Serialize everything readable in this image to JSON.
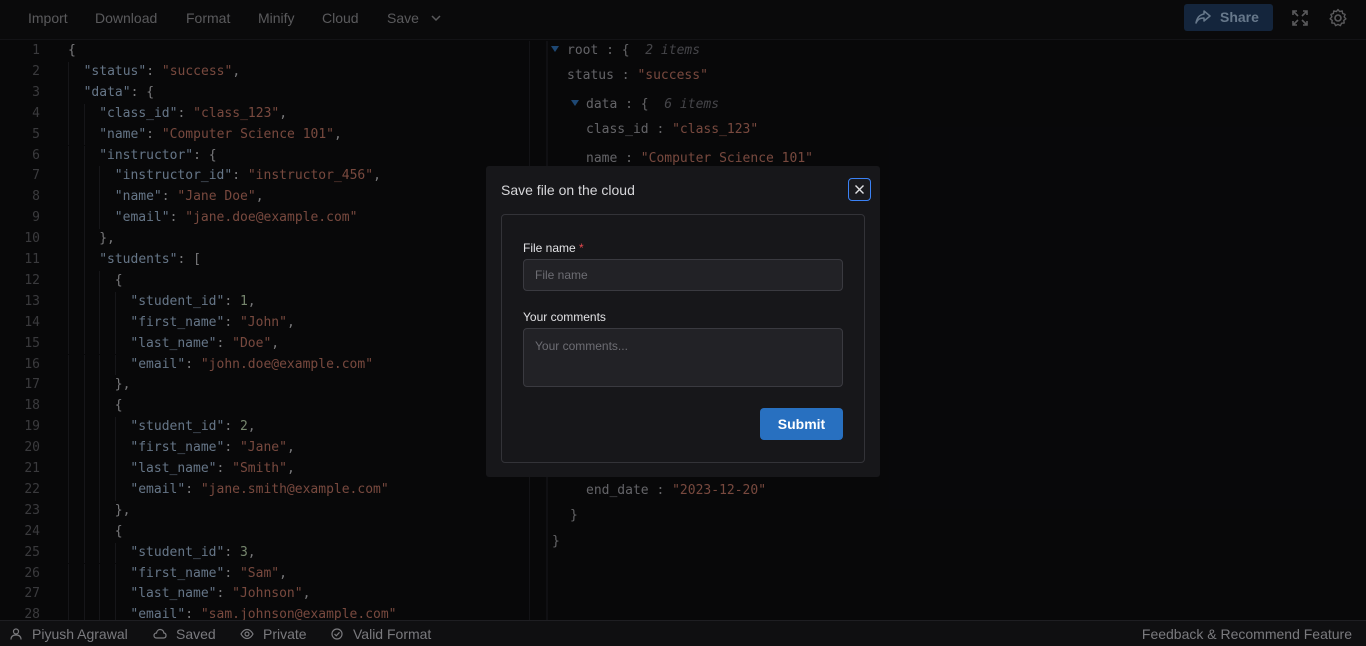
{
  "toolbar": {
    "menus": [
      "Import",
      "Download",
      "Format",
      "Minify",
      "Cloud",
      "Save"
    ],
    "share_label": "Share"
  },
  "editor": {
    "line_numbers": [
      "1",
      "2",
      "3",
      "4",
      "5",
      "6",
      "7",
      "8",
      "9",
      "10",
      "11",
      "12",
      "13",
      "14",
      "15",
      "16",
      "17",
      "18",
      "19",
      "20",
      "21",
      "22",
      "23",
      "24",
      "25",
      "26",
      "27",
      "28"
    ],
    "lines": [
      "{",
      "  \"status\": \"success\",",
      "  \"data\": {",
      "    \"class_id\": \"class_123\",",
      "    \"name\": \"Computer Science 101\",",
      "    \"instructor\": {",
      "      \"instructor_id\": \"instructor_456\",",
      "      \"name\": \"Jane Doe\",",
      "      \"email\": \"jane.doe@example.com\"",
      "    },",
      "    \"students\": [",
      "      {",
      "        \"student_id\": 1,",
      "        \"first_name\": \"John\",",
      "        \"last_name\": \"Doe\",",
      "        \"email\": \"john.doe@example.com\"",
      "      },",
      "      {",
      "        \"student_id\": 2,",
      "        \"first_name\": \"Jane\",",
      "        \"last_name\": \"Smith\",",
      "        \"email\": \"jane.smith@example.com\"",
      "      },",
      "      {",
      "        \"student_id\": 3,",
      "        \"first_name\": \"Sam\",",
      "        \"last_name\": \"Johnson\",",
      "        \"email\": \"sam.johnson@example.com\""
    ]
  },
  "tree": {
    "root_label": "root",
    "root_meta": "2 items",
    "status_key": "status",
    "status_value": "\"success\"",
    "data_key": "data",
    "data_meta": "6 items",
    "class_id_key": "class_id",
    "class_id_value": "\"class_123\"",
    "name_key": "name",
    "name_value": "\"Computer Science 101\"",
    "end_date_key": "end_date",
    "end_date_value": "\"2023-12-20\""
  },
  "modal": {
    "title": "Save file on the cloud",
    "file_name_label": "File name",
    "required_mark": "*",
    "file_name_placeholder": "File name",
    "file_name_value": "",
    "comments_label": "Your comments",
    "comments_placeholder": "Your comments...",
    "comments_value": "",
    "submit_label": "Submit"
  },
  "status_bar": {
    "user": "Piyush Agrawal",
    "saved": "Saved",
    "visibility": "Private",
    "validity": "Valid Format",
    "feedback": "Feedback & Recommend Feature"
  },
  "colors": {
    "accent": "#2870c0",
    "share_bg": "#1f3a5c",
    "string": "#b87060",
    "key": "#9cb4cf",
    "required": "#e5484d"
  },
  "icons": {
    "save_caret": "chevron-down-icon",
    "share": "share-icon",
    "fullscreen": "fullscreen-icon",
    "settings": "gear-icon",
    "close": "close-icon",
    "user": "user-icon",
    "saved": "cloud-icon",
    "private": "eye-icon",
    "valid": "check-circle-icon"
  }
}
